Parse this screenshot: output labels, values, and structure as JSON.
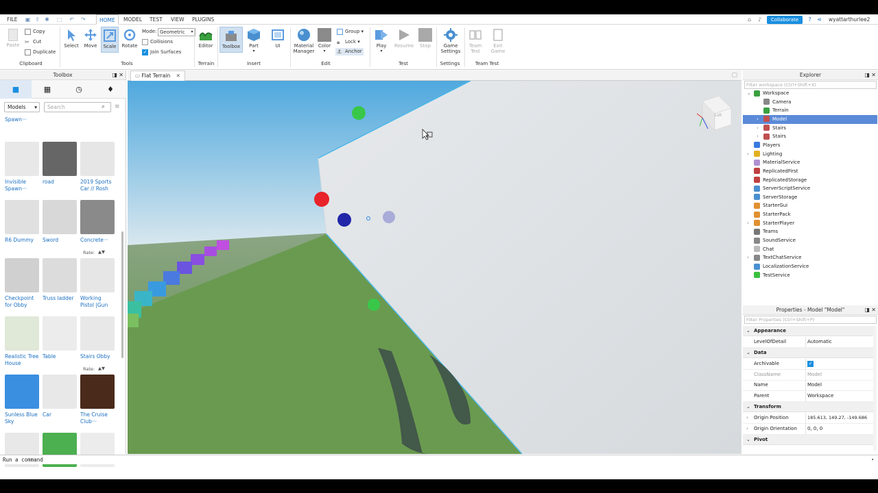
{
  "menubar": {
    "file": "FILE",
    "tabs": [
      "HOME",
      "MODEL",
      "TEST",
      "VIEW",
      "PLUGINS"
    ],
    "active_tab": "HOME",
    "collaborate": "Collaborate",
    "username": "wyattarthurlee2"
  },
  "ribbon": {
    "clipboard": {
      "paste": "Paste",
      "copy": "Copy",
      "cut": "Cut",
      "duplicate": "Duplicate",
      "label": "Clipboard"
    },
    "tools": {
      "select": "Select",
      "move": "Move",
      "scale": "Scale",
      "rotate": "Rotate",
      "mode_label": "Mode:",
      "mode_value": "Geometric",
      "collisions": "Collisions",
      "join_surfaces": "Join Surfaces",
      "label": "Tools"
    },
    "terrain": {
      "editor": "Editor",
      "label": "Terrain"
    },
    "insert": {
      "toolbox": "Toolbox",
      "part": "Part",
      "ui": "UI",
      "label": "Insert"
    },
    "edit": {
      "material_manager": "Material Manager",
      "color": "Color",
      "group": "Group",
      "lock": "Lock",
      "anchor": "Anchor",
      "label": "Edit"
    },
    "test": {
      "play": "Play",
      "resume": "Resume",
      "stop": "Stop",
      "label": "Test"
    },
    "settings": {
      "game_settings": "Game Settings",
      "label": "Settings"
    },
    "team_test": {
      "team_test": "Team Test",
      "exit_game": "Exit Game",
      "label": "Team Test"
    }
  },
  "toolbox": {
    "title": "Toolbox",
    "category": "Models",
    "search_placeholder": "Search",
    "partial_top": "Spawn···",
    "rate_label": "Rate:",
    "items": [
      {
        "name": "Invisible Spawn···",
        "color": "#e8e8e8"
      },
      {
        "name": "road",
        "color": "#666666"
      },
      {
        "name": "2019 Sports Car // Rosh",
        "color": "#e6e6e6"
      },
      {
        "name": "R6 Dummy",
        "color": "#e0e0e0"
      },
      {
        "name": "Sword",
        "color": "#d8d8d8"
      },
      {
        "name": "Concrete···",
        "color": "#8a8a8a"
      },
      {
        "name": "Checkpoint for Obby",
        "color": "#d0d0d0"
      },
      {
        "name": "Truss ladder",
        "color": "#dcdcdc"
      },
      {
        "name": "Working Pistol |Gun",
        "color": "#e6e6e6"
      },
      {
        "name": "Realistic Tree House",
        "color": "#e0e8d8"
      },
      {
        "name": "Table",
        "color": "#ececec"
      },
      {
        "name": "Stairs Obby",
        "color": "#e8e8e8"
      },
      {
        "name": "Sunless Blue Sky",
        "color": "#3a8fe0"
      },
      {
        "name": "Car",
        "color": "#e8e8e8"
      },
      {
        "name": "The Cruise Club···",
        "color": "#4a2a1a"
      },
      {
        "name": "",
        "color": "#e8e8e8"
      },
      {
        "name": "",
        "color": "#4caf50"
      },
      {
        "name": "",
        "color": "#ececec"
      }
    ]
  },
  "viewport": {
    "tab": "Flat Terrain",
    "view_cube_label": "Left"
  },
  "explorer": {
    "title": "Explorer",
    "filter_placeholder": "Filter workspace (Ctrl+Shift+X)",
    "items": [
      {
        "label": "Workspace",
        "selected": false
      },
      {
        "label": "Camera",
        "selected": false
      },
      {
        "label": "Terrain",
        "selected": false
      },
      {
        "label": "Model",
        "selected": true
      },
      {
        "label": "Stairs",
        "selected": false
      },
      {
        "label": "Stairs",
        "selected": false
      },
      {
        "label": "Players",
        "selected": false
      },
      {
        "label": "Lighting",
        "selected": false
      },
      {
        "label": "MaterialService",
        "selected": false
      },
      {
        "label": "ReplicatedFirst",
        "selected": false
      },
      {
        "label": "ReplicatedStorage",
        "selected": false
      },
      {
        "label": "ServerScriptService",
        "selected": false
      },
      {
        "label": "ServerStorage",
        "selected": false
      },
      {
        "label": "StarterGui",
        "selected": false
      },
      {
        "label": "StarterPack",
        "selected": false
      },
      {
        "label": "StarterPlayer",
        "selected": false
      },
      {
        "label": "Teams",
        "selected": false
      },
      {
        "label": "SoundService",
        "selected": false
      },
      {
        "label": "Chat",
        "selected": false
      },
      {
        "label": "TextChatService",
        "selected": false
      },
      {
        "label": "LocalizationService",
        "selected": false
      },
      {
        "label": "TestService",
        "selected": false
      }
    ]
  },
  "properties": {
    "title": "Properties - Model \"Model\"",
    "filter_placeholder": "Filter Properties (Ctrl+Shift+P)",
    "sections": {
      "appearance": "Appearance",
      "data": "Data",
      "transform": "Transform",
      "pivot": "Pivot"
    },
    "rows": {
      "level_of_detail": {
        "name": "LevelOfDetail",
        "value": "Automatic"
      },
      "archivable": {
        "name": "Archivable",
        "value": "✓"
      },
      "class_name": {
        "name": "ClassName",
        "value": "Model"
      },
      "name": {
        "name": "Name",
        "value": "Model"
      },
      "parent": {
        "name": "Parent",
        "value": "Workspace"
      },
      "origin_position": {
        "name": "Origin Position",
        "value": "185.613, 149.27, -149.686"
      },
      "origin_orientation": {
        "name": "Origin Orientation",
        "value": "0, 0, 0"
      }
    }
  },
  "command_bar": {
    "placeholder": "Run a command"
  },
  "colors": {
    "accent": "#1a8fe0",
    "selection": "#5b8ad8",
    "sky": "#7ec4e8",
    "ground": "#6a9a50",
    "wall": "#dfe3e6"
  }
}
